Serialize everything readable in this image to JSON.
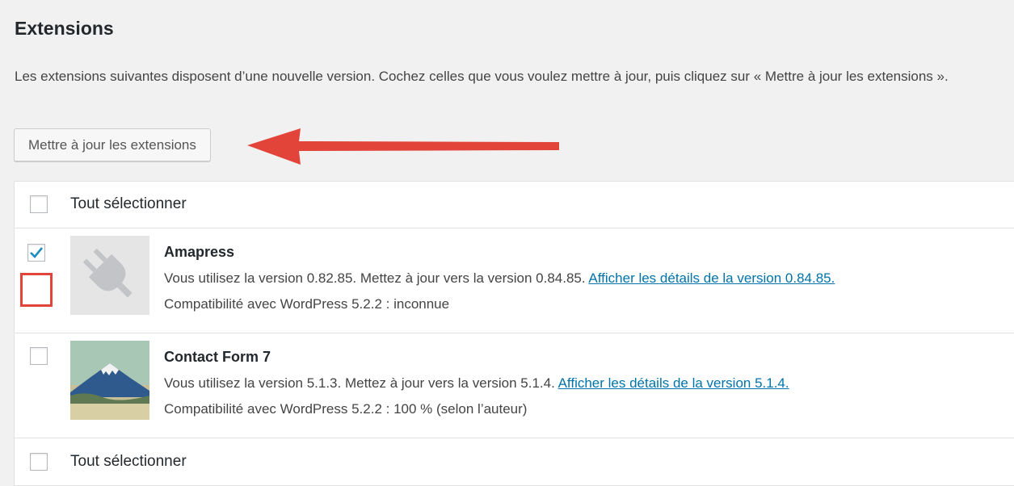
{
  "section": {
    "title": "Extensions",
    "intro": "Les extensions suivantes disposent d’une nouvelle version. Cochez celles que vous voulez mettre à jour, puis cliquez sur « Mettre à jour les extensions ».",
    "update_button": "Mettre à jour les extensions",
    "annotation_arrow_icon": "red-arrow-left",
    "annotation_color": "#e2443a"
  },
  "table": {
    "select_all_label": "Tout sélectionner",
    "select_all_checked": false,
    "plugins": [
      {
        "name": "Amapress",
        "checked": true,
        "icon": "plug-icon",
        "version_text": "Vous utilisez la version 0.82.85. Mettez à jour vers la version 0.84.85. ",
        "details_link": "Afficher les détails de la version 0.84.85.",
        "compat": "Compatibilité avec WordPress 5.2.2 : inconnue"
      },
      {
        "name": "Contact Form 7",
        "checked": false,
        "icon": "mount-fuji-icon",
        "version_text": "Vous utilisez la version 5.1.3. Mettez à jour vers la version 5.1.4. ",
        "details_link": "Afficher les détails de la version 5.1.4.",
        "compat": "Compatibilité avec WordPress 5.2.2 : 100 % (selon l’auteur)"
      }
    ]
  },
  "colors": {
    "link": "#0073aa",
    "checkmark": "#1e8cbe"
  }
}
